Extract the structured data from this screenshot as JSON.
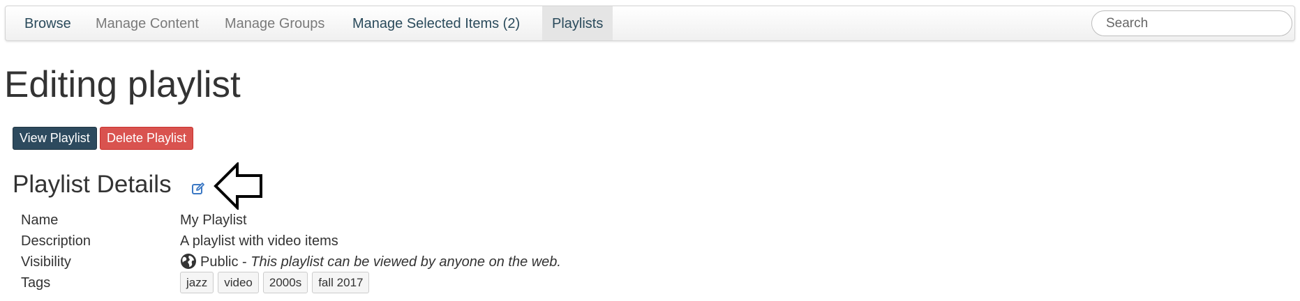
{
  "navbar": {
    "items": [
      {
        "label": "Browse"
      },
      {
        "label": "Manage Content"
      },
      {
        "label": "Manage Groups"
      },
      {
        "label": "Manage Selected Items (2)"
      },
      {
        "label": "Playlists"
      }
    ],
    "search": {
      "placeholder": "Search",
      "value": ""
    }
  },
  "page": {
    "title": "Editing playlist"
  },
  "actions": {
    "view_label": "View Playlist",
    "delete_label": "Delete Playlist"
  },
  "details": {
    "title": "Playlist Details",
    "rows": {
      "name": {
        "label": "Name",
        "value": "My Playlist"
      },
      "description": {
        "label": "Description",
        "value": "A playlist with video items"
      },
      "visibility": {
        "label": "Visibility",
        "value": "Public",
        "separator": "-",
        "note": "This playlist can be viewed by anyone on the web."
      },
      "tags": {
        "label": "Tags",
        "values": [
          "jazz",
          "video",
          "2000s",
          "fall 2017"
        ]
      }
    }
  },
  "icons": {
    "edit": "edit-icon",
    "globe": "globe-icon",
    "annotation": "arrow-marker"
  },
  "colors": {
    "primary": "#2d4a5e",
    "danger": "#d9534f",
    "nav_active_bg": "#e5e5e5",
    "link_dark": "#2a4a5b",
    "muted": "#7a7a7a"
  }
}
